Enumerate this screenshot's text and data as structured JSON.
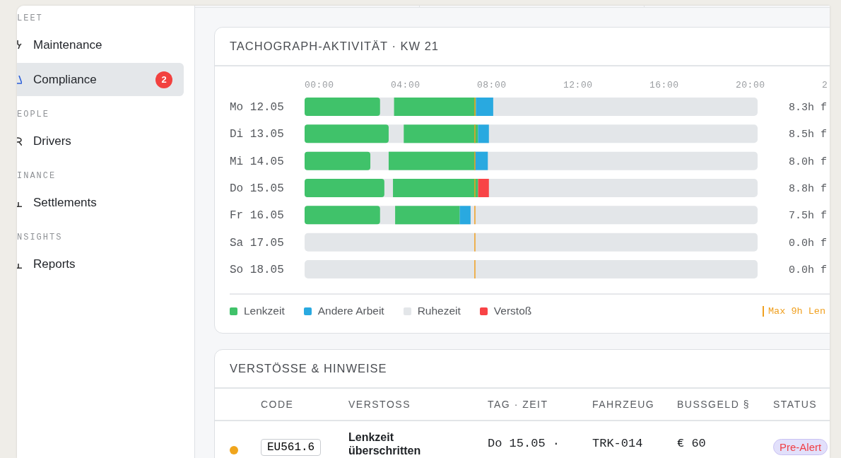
{
  "sidebar": {
    "sections": [
      {
        "label": "LEET",
        "items": [
          {
            "label": "Maintenance",
            "selected": false
          }
        ]
      },
      {
        "items": [
          {
            "label": "Compliance",
            "selected": true,
            "badge": "2"
          }
        ]
      },
      {
        "label": "EOPLE",
        "items": [
          {
            "label": "Drivers",
            "selected": false
          }
        ]
      },
      {
        "label": "INANCE",
        "items": [
          {
            "label": "Settlements",
            "selected": false
          }
        ]
      },
      {
        "label": "NSIGHTS",
        "items": [
          {
            "label": "Reports",
            "selected": false
          }
        ]
      }
    ]
  },
  "activity_card": {
    "title": "TACHOGRAPH-AKTIVITÄT · KW 21",
    "time_labels": [
      "00:00",
      "04:00",
      "08:00",
      "12:00",
      "16:00",
      "20:00",
      "2"
    ],
    "days": [
      {
        "label": "Mo 12.05",
        "hours": "8.3h f"
      },
      {
        "label": "Di 13.05",
        "hours": "8.5h f"
      },
      {
        "label": "Mi 14.05",
        "hours": "8.0h f"
      },
      {
        "label": "Do 15.05",
        "hours": "8.8h f"
      },
      {
        "label": "Fr 16.05",
        "hours": "7.5h f"
      },
      {
        "label": "Sa 17.05",
        "hours": "0.0h f"
      },
      {
        "label": "So 18.05",
        "hours": "0.0h f"
      }
    ],
    "legend": [
      {
        "label": "Lenkzeit",
        "color": "#40c26a"
      },
      {
        "label": "Andere Arbeit",
        "color": "#29a9e0"
      },
      {
        "label": "Ruhezeit",
        "color": "#e3e6e9"
      },
      {
        "label": "Verstoß",
        "color": "#f84346"
      }
    ],
    "limit_label": "Max 9h Len"
  },
  "violations_card": {
    "title": "VERSTÖSSE & HINWEISE",
    "columns": [
      "CODE",
      "VERSTOSS",
      "TAG · ZEIT",
      "FAHRZEUG",
      "BUSSGELD §",
      "STATUS"
    ],
    "rows": [
      {
        "color": "#f0a51c",
        "code": "EU561.6",
        "violation": "Lenkzeit überschritten",
        "day_time": "Do 15.05 ·",
        "vehicle": "TRK-014",
        "fine": "€ 60",
        "status": "Pre-Alert"
      }
    ]
  }
}
